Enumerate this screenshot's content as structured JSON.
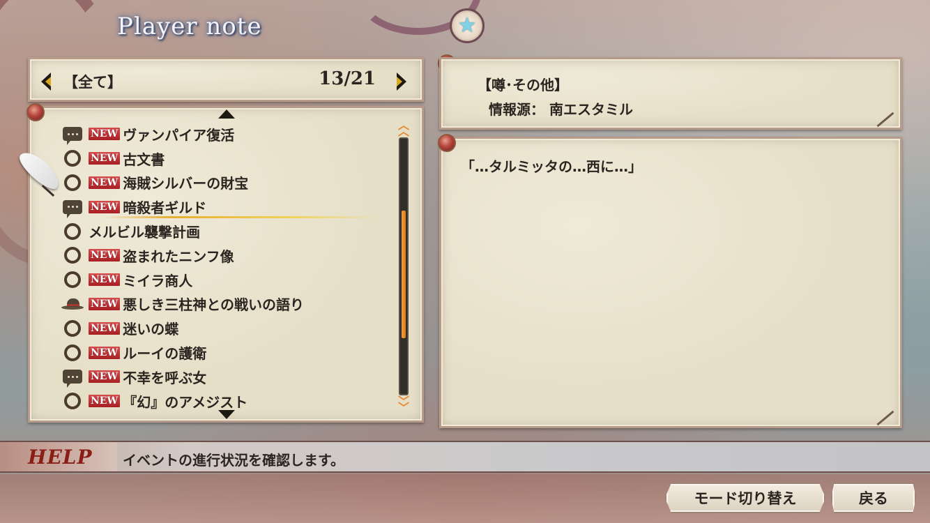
{
  "screen": {
    "title": "Player note"
  },
  "category_bar": {
    "label": "【全て】",
    "count": "13/21"
  },
  "event_list": [
    {
      "icon": "speech-bubble-icon",
      "is_new": true,
      "new_label": "NEW",
      "title": "ヴァンパイア復活",
      "selected": false
    },
    {
      "icon": "ring-icon",
      "is_new": true,
      "new_label": "NEW",
      "title": "古文書",
      "selected": false
    },
    {
      "icon": "ring-icon",
      "is_new": true,
      "new_label": "NEW",
      "title": "海賊シルバーの財宝",
      "selected": false
    },
    {
      "icon": "speech-bubble-icon",
      "is_new": true,
      "new_label": "NEW",
      "title": "暗殺者ギルド",
      "selected": true
    },
    {
      "icon": "ring-icon",
      "is_new": false,
      "new_label": "",
      "title": "メルビル襲撃計画",
      "selected": false
    },
    {
      "icon": "ring-icon",
      "is_new": true,
      "new_label": "NEW",
      "title": "盗まれたニンフ像",
      "selected": false
    },
    {
      "icon": "ring-icon",
      "is_new": true,
      "new_label": "NEW",
      "title": "ミイラ商人",
      "selected": false
    },
    {
      "icon": "hat-icon",
      "is_new": true,
      "new_label": "NEW",
      "title": "悪しき三柱神との戦いの語り",
      "selected": false
    },
    {
      "icon": "ring-icon",
      "is_new": true,
      "new_label": "NEW",
      "title": "迷いの蝶",
      "selected": false
    },
    {
      "icon": "ring-icon",
      "is_new": true,
      "new_label": "NEW",
      "title": "ルーイの護衛",
      "selected": false
    },
    {
      "icon": "speech-bubble-icon",
      "is_new": true,
      "new_label": "NEW",
      "title": "不幸を呼ぶ女",
      "selected": false
    },
    {
      "icon": "ring-icon",
      "is_new": true,
      "new_label": "NEW",
      "title": "『幻』のアメジスト",
      "selected": false
    }
  ],
  "scroll": {
    "position_fraction": 0.55,
    "visible_fraction": 0.5
  },
  "info": {
    "category": "【噂･その他】",
    "source": "情報源： 南エスタミル"
  },
  "detail": {
    "text": "「…タルミッタの…西に…」"
  },
  "help": {
    "label": "HELP",
    "text": "イベントの進行状況を確認します。"
  },
  "buttons": {
    "mode": "モード切り替え",
    "back": "戻る"
  },
  "colors": {
    "new_badge": "#a81f24",
    "scroll_thumb": "#e07b1e",
    "help_label": "#8a1d16"
  }
}
